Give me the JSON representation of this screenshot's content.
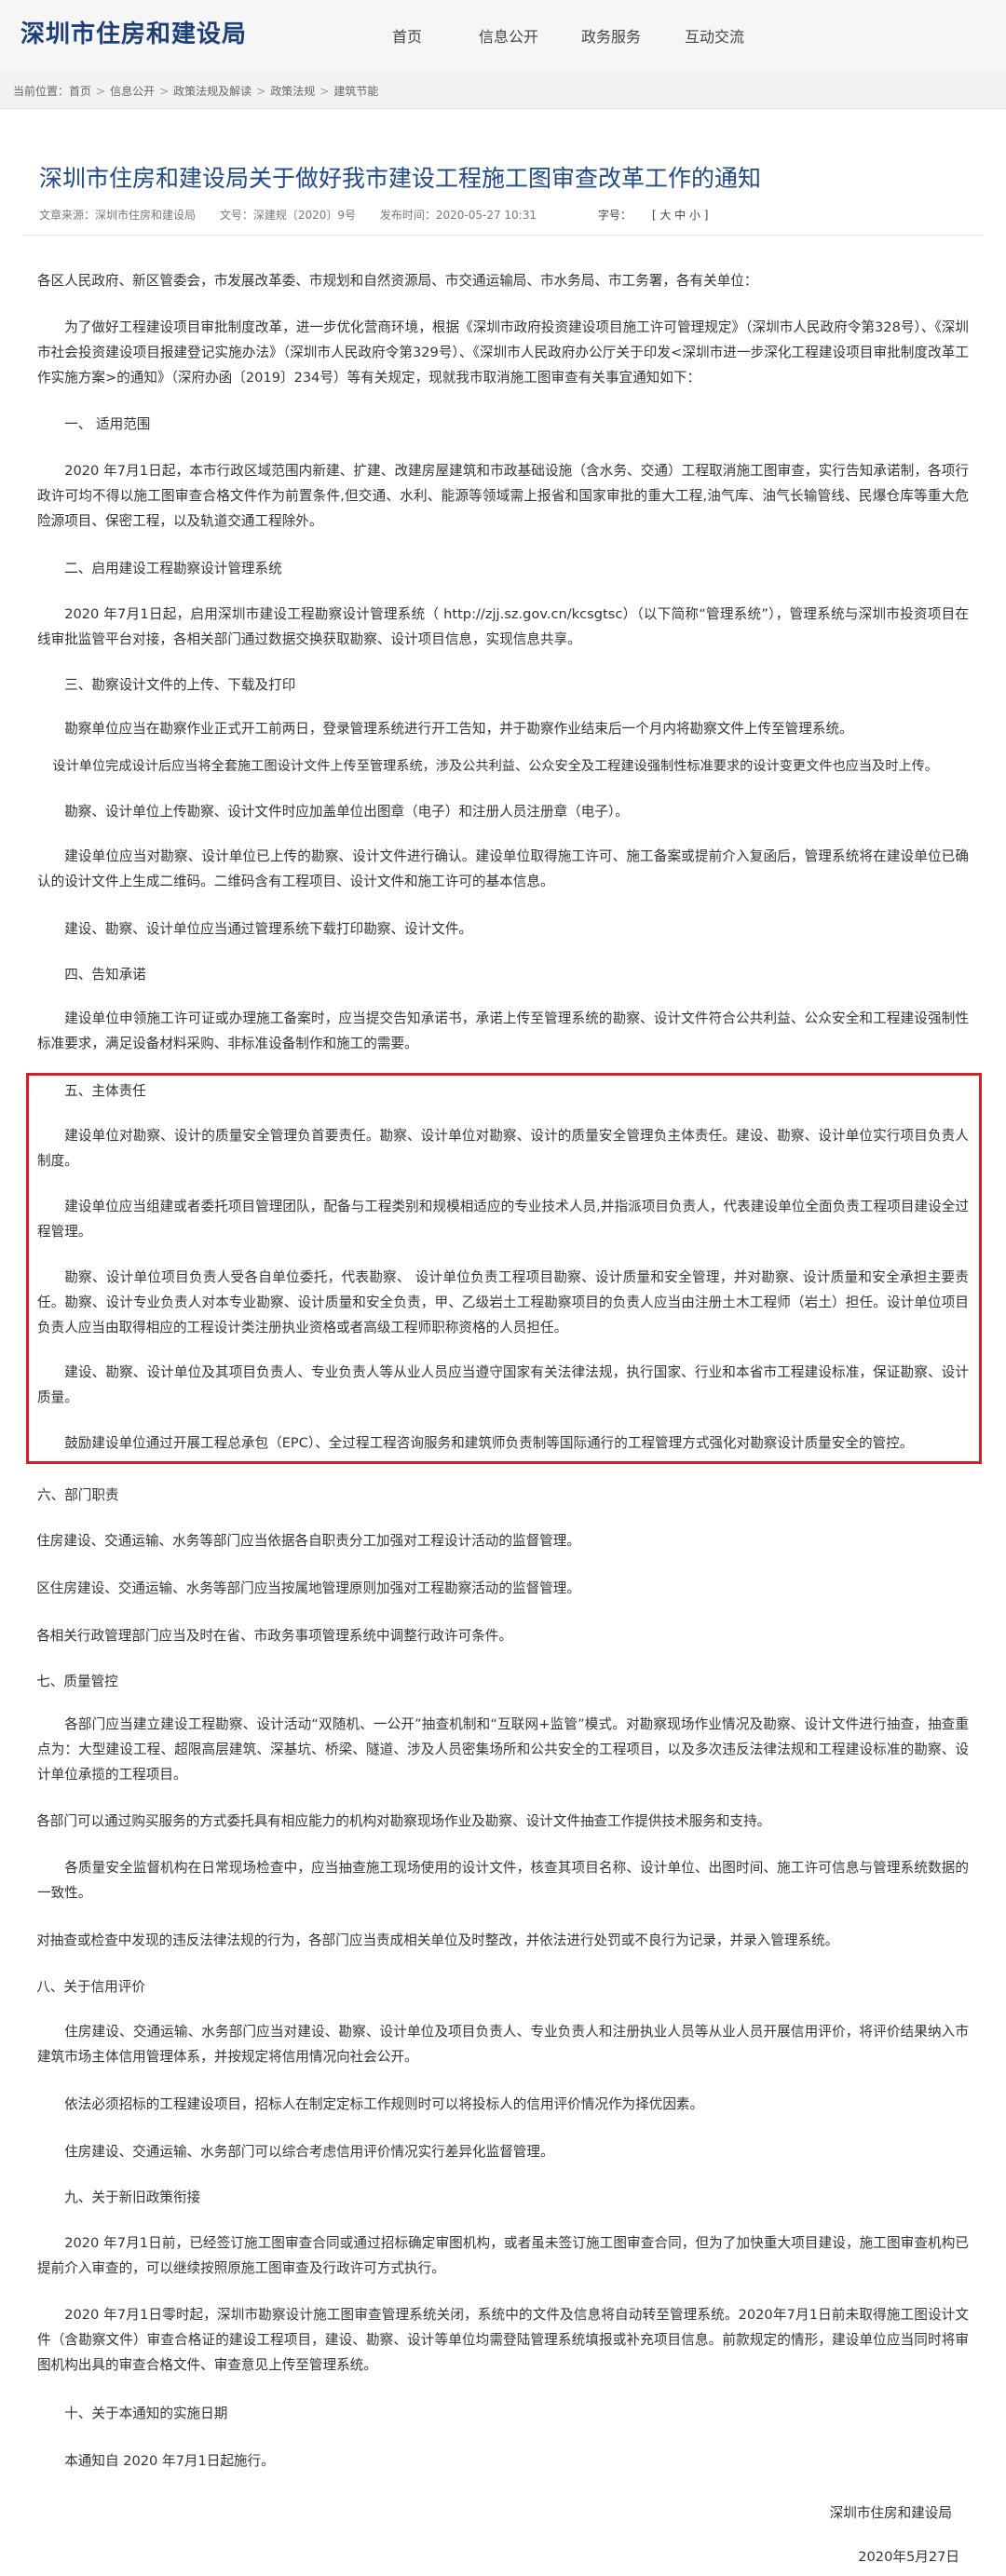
{
  "header": {
    "logo": "深圳市住房和建设局",
    "nav": [
      "首页",
      "信息公开",
      "政务服务",
      "互动交流"
    ]
  },
  "breadcrumb": {
    "prefix": "当前位置：",
    "items": [
      "首页",
      "信息公开",
      "政策法规及解读",
      "政策法规",
      "建筑节能"
    ]
  },
  "article": {
    "title": "深圳市住房和建设局关于做好我市建设工程施工图审查改革工作的通知",
    "meta": {
      "source": "文章来源：深圳市住房和建设局",
      "doc_no": "文号：深建规〔2020〕9号",
      "date": "发布时间：2020-05-27 10:31",
      "font_size_label": "字号：",
      "font_sizes": "[ 大  中  小 ]"
    },
    "salutation": "各区人民政府、新区管委会，市发展改革委、市规划和自然资源局、市交通运输局、市水务局、市工务署，各有关单位：",
    "intro": "为了做好工程建设项目审批制度改革，进一步优化营商环境，根据《深圳市政府投资建设项目施工许可管理规定》（深圳市人民政府令第328号）、《深圳市社会投资建设项目报建登记实施办法》（深圳市人民政府令第329号）、《深圳市人民政府办公厅关于印发<深圳市进一步深化工程建设项目审批制度改革工作实施方案>的通知》（深府办函〔2019〕234号）等有关规定，现就我市取消施工图审查有关事宜通知如下：",
    "s1_title": "一、 适用范围",
    "s1_p1": "2020 年7月1日起，本市行政区域范围内新建、扩建、改建房屋建筑和市政基础设施（含水务、交通）工程取消施工图审查，实行告知承诺制，各项行政许可均不得以施工图审查合格文件作为前置条件,但交通、水利、能源等领域需上报省和国家审批的重大工程,油气库、油气长输管线、民爆仓库等重大危险源项目、保密工程，以及轨道交通工程除外。",
    "s2_title": "二、启用建设工程勘察设计管理系统",
    "s2_p1": "2020 年7月1日起，启用深圳市建设工程勘察设计管理系统（ http://zjj.sz.gov.cn/kcsgtsc）（以下简称“管理系统”），管理系统与深圳市投资项目在线审批监管平台对接，各相关部门通过数据交换获取勘察、设计项目信息，实现信息共享。",
    "s3_title": "三、勘察设计文件的上传、下载及打印",
    "s3_p1": "勘察单位应当在勘察作业正式开工前两日，登录管理系统进行开工告知，并于勘察作业结束后一个月内将勘察文件上传至管理系统。",
    "s3_p2": "设计单位完成设计后应当将全套施工图设计文件上传至管理系统，涉及公共利益、公众安全及工程建设强制性标准要求的设计变更文件也应当及时上传。",
    "s3_p3": "勘察、设计单位上传勘察、设计文件时应加盖单位出图章（电子）和注册人员注册章（电子）。",
    "s3_p4": "建设单位应当对勘察、设计单位已上传的勘察、设计文件进行确认。建设单位取得施工许可、施工备案或提前介入复函后，管理系统将在建设单位已确认的设计文件上生成二维码。二维码含有工程项目、设计文件和施工许可的基本信息。",
    "s3_p5": "建设、勘察、设计单位应当通过管理系统下载打印勘察、设计文件。",
    "s4_title": "四、告知承诺",
    "s4_p1": "建设单位申领施工许可证或办理施工备案时，应当提交告知承诺书，承诺上传至管理系统的勘察、设计文件符合公共利益、公众安全和工程建设强制性标准要求，满足设备材料采购、非标准设备制作和施工的需要。",
    "s5_title": "五、主体责任",
    "s5_p1": "建设单位对勘察、设计的质量安全管理负首要责任。勘察、设计单位对勘察、设计的质量安全管理负主体责任。建设、勘察、设计单位实行项目负责人制度。",
    "s5_p2": "建设单位应当组建或者委托项目管理团队，配备与工程类别和规模相适应的专业技术人员,并指派项目负责人，代表建设单位全面负责工程项目建设全过程管理。",
    "s5_p3": "勘察、设计单位项目负责人受各自单位委托，代表勘察、 设计单位负责工程项目勘察、设计质量和安全管理，并对勘察、设计质量和安全承担主要责任。勘察、设计专业负责人对本专业勘察、设计质量和安全负责，甲、乙级岩土工程勘察项目的负责人应当由注册土木工程师（岩土）担任。设计单位项目负责人应当由取得相应的工程设计类注册执业资格或者高级工程师职称资格的人员担任。",
    "s5_p4": "建设、勘察、设计单位及其项目负责人、专业负责人等从业人员应当遵守国家有关法律法规，执行国家、行业和本省市工程建设标准，保证勘察、设计质量。",
    "s5_p5": "鼓励建设单位通过开展工程总承包（EPC）、全过程工程咨询服务和建筑师负责制等国际通行的工程管理方式强化对勘察设计质量安全的管控。",
    "s6_title": "六、部门职责",
    "s6_p1": "住房建设、交通运输、水务等部门应当依据各自职责分工加强对工程设计活动的监督管理。",
    "s6_p2": "区住房建设、交通运输、水务等部门应当按属地管理原则加强对工程勘察活动的监督管理。",
    "s6_p3": "各相关行政管理部门应当及时在省、市政务事项管理系统中调整行政许可条件。",
    "s7_title": "七、质量管控",
    "s7_p1": "各部门应当建立建设工程勘察、设计活动“双随机、一公开”抽查机制和“互联网+监管”模式。对勘察现场作业情况及勘察、设计文件进行抽查，抽查重点为：大型建设工程、超限高层建筑、深基坑、桥梁、隧道、涉及人员密集场所和公共安全的工程项目，以及多次违反法律法规和工程建设标准的勘察、设计单位承揽的工程项目。",
    "s7_p2": "各部门可以通过购买服务的方式委托具有相应能力的机构对勘察现场作业及勘察、设计文件抽查工作提供技术服务和支持。",
    "s7_p3": "各质量安全监督机构在日常现场检查中，应当抽查施工现场使用的设计文件，核查其项目名称、设计单位、出图时间、施工许可信息与管理系统数据的一致性。",
    "s7_p4": "对抽查或检查中发现的违反法律法规的行为，各部门应当责成相关单位及时整改，并依法进行处罚或不良行为记录，并录入管理系统。",
    "s8_title": "八、关于信用评价",
    "s8_p1": "住房建设、交通运输、水务部门应当对建设、勘察、设计单位及项目负责人、专业负责人和注册执业人员等从业人员开展信用评价，将评价结果纳入市建筑市场主体信用管理体系，并按规定将信用情况向社会公开。",
    "s8_p2": "依法必须招标的工程建设项目，招标人在制定定标工作规则时可以将投标人的信用评价情况作为择优因素。",
    "s8_p3": "住房建设、交通运输、水务部门可以综合考虑信用评价情况实行差异化监督管理。",
    "s9_title": "九、关于新旧政策衔接",
    "s9_p1": "2020 年7月1日前，已经签订施工图审查合同或通过招标确定审图机构，或者虽未签订施工图审查合同，但为了加快重大项目建设，施工图审查机构已提前介入审查的，可以继续按照原施工图审查及行政许可方式执行。",
    "s9_p2": "2020 年7月1日零时起，深圳市勘察设计施工图审查管理系统关闭，系统中的文件及信息将自动转至管理系统。2020年7月1日前未取得施工图设计文件（含勘察文件）审查合格证的建设工程项目，建设、勘察、设计等单位均需登陆管理系统填报或补充项目信息。前款规定的情形，建设单位应当同时将审图机构出具的审查合格文件、审查意见上传至管理系统。",
    "s10_title": "十、关于本通知的实施日期",
    "s10_p1": "本通知自 2020 年7月1日起施行。",
    "signature": "深圳市住房和建设局",
    "sign_date": "2020年5月27日"
  }
}
